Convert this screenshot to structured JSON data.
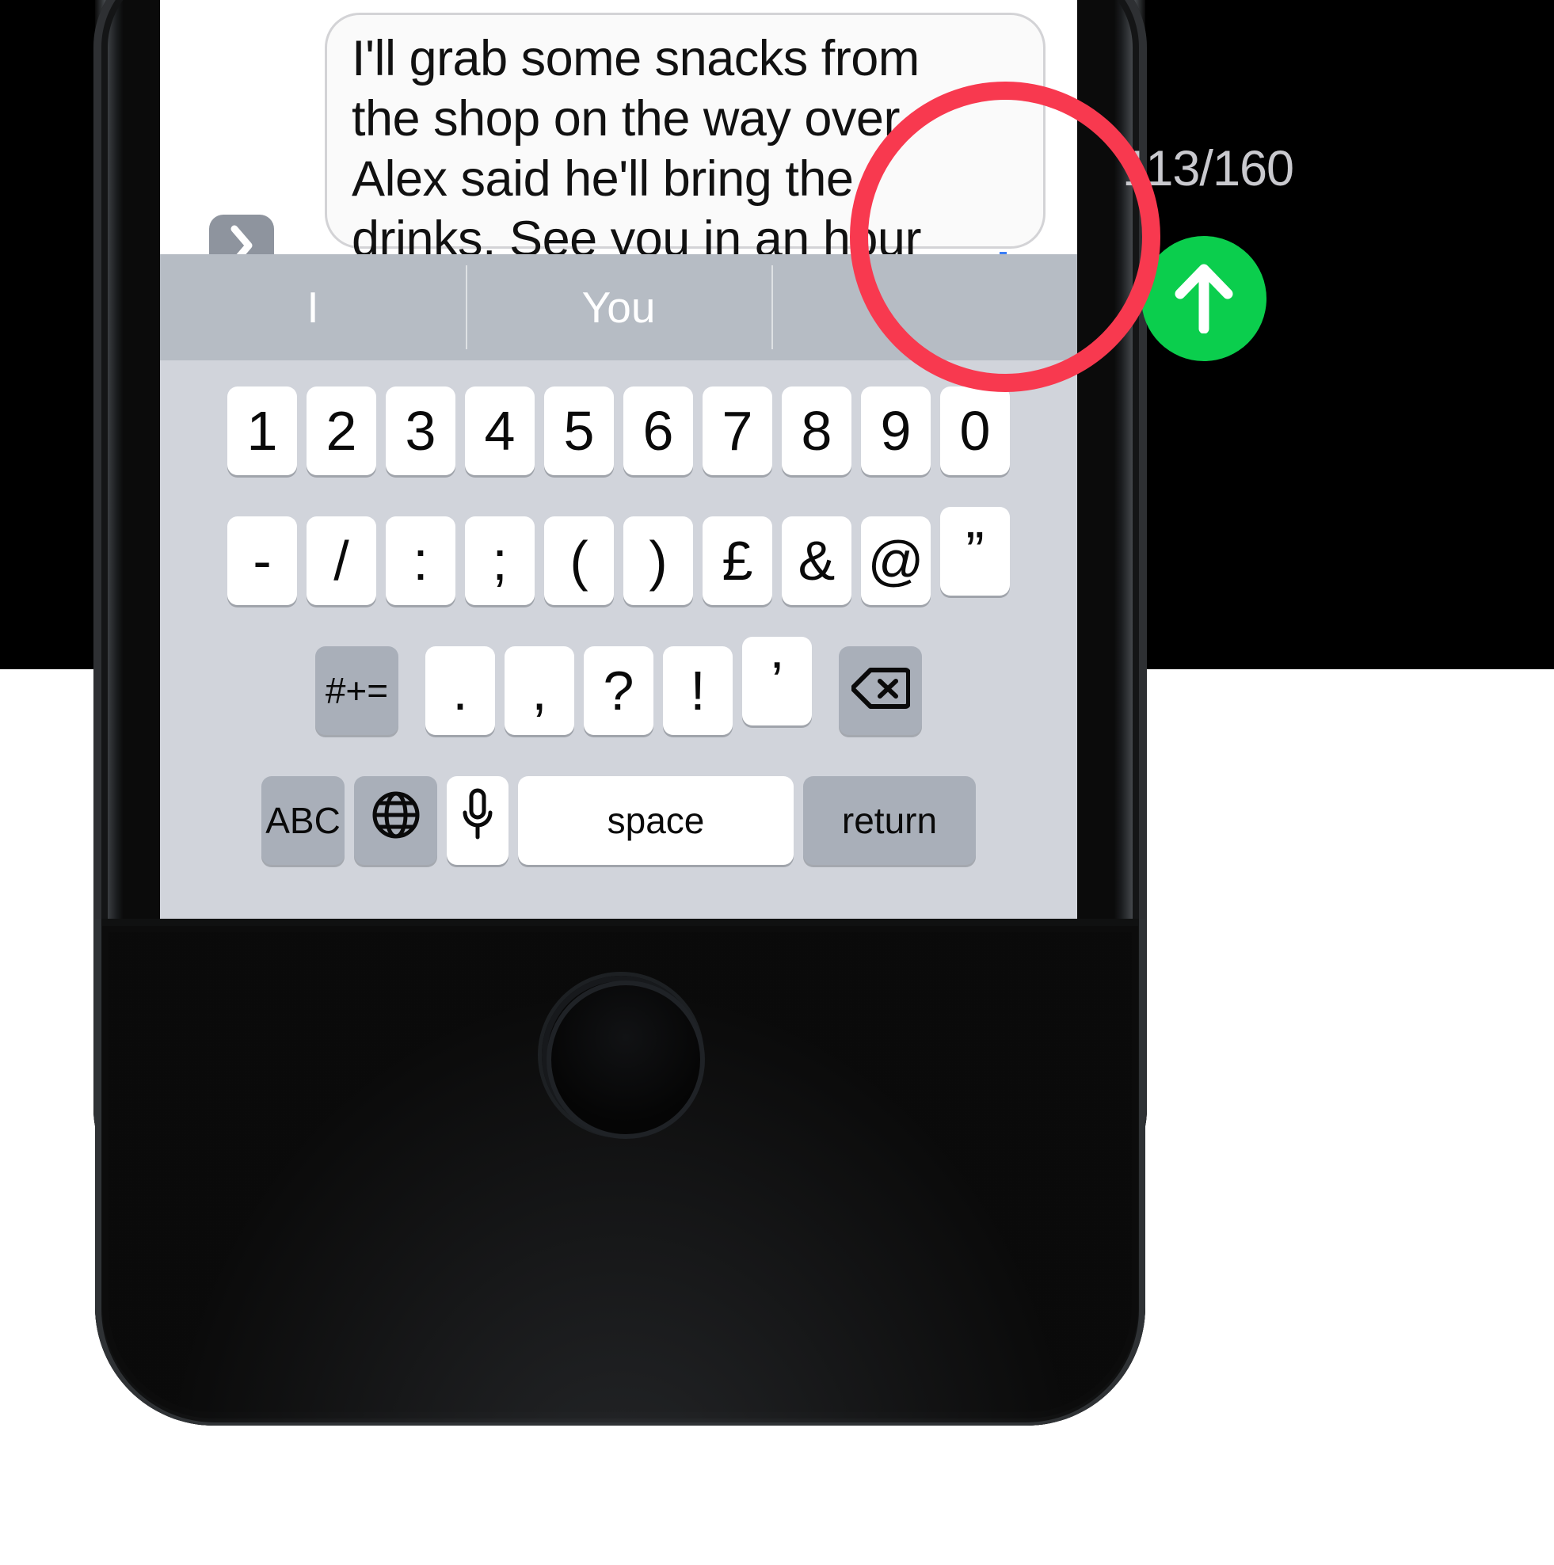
{
  "device": {
    "name": "iphone",
    "home_button": "home-button"
  },
  "conversation": {
    "outgoing_bubble_color": "#0BCE4D",
    "compose": {
      "text": "I'll grab some snacks from the shop on the way over, Alex said he'll bring the drinks. See you in an hour or two!",
      "expand_icon": "chevron-right-icon",
      "caret_color": "#3B7EF5"
    }
  },
  "counter": {
    "value": "113/160",
    "used": 113,
    "limit": 160,
    "color": "#C9C9CE"
  },
  "send_button": {
    "icon": "arrow-up-icon",
    "color": "#0BCE4D",
    "label": "Send"
  },
  "highlight": {
    "shape": "circle",
    "color": "#F8394F",
    "target": "send-button-and-character-counter"
  },
  "keyboard": {
    "layout": "numeric-symbols",
    "suggestions": [
      "I",
      "You",
      ""
    ],
    "rows": {
      "numbers": [
        "1",
        "2",
        "3",
        "4",
        "5",
        "6",
        "7",
        "8",
        "9",
        "0"
      ],
      "symbols": [
        "-",
        "/",
        ":",
        ";",
        "(",
        ")",
        "£",
        "&",
        "@",
        "”"
      ],
      "punctuation": {
        "shift_label": "#+=",
        "keys": [
          ".",
          ",",
          "?",
          "!",
          "’"
        ],
        "backspace_icon": "backspace-icon"
      },
      "bottom": {
        "abc_label": "ABC",
        "globe_icon": "globe-icon",
        "mic_icon": "microphone-icon",
        "space_label": "space",
        "return_label": "return"
      }
    },
    "colors": {
      "background": "#D1D4DB",
      "suggestion_bar": "#B6BCC4",
      "key": "#FFFFFF",
      "modifier_key": "#A9AFB9"
    }
  }
}
